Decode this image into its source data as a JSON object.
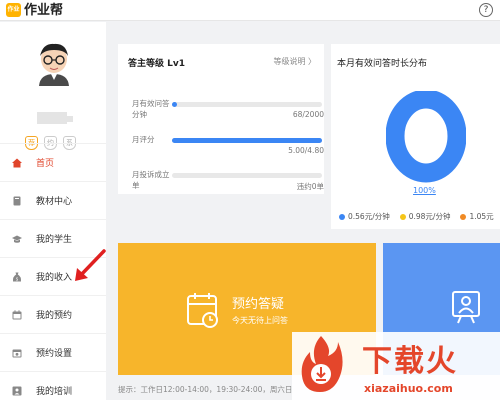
{
  "app": {
    "logo_text": "作业",
    "name": "作业帮",
    "help": "?"
  },
  "sidebar": {
    "badges": [
      "荐",
      "约",
      "系"
    ],
    "items": [
      {
        "label": "首页",
        "icon": "home-icon",
        "active": true
      },
      {
        "label": "教材中心",
        "icon": "book-icon"
      },
      {
        "label": "我的学生",
        "icon": "graduation-cap-icon"
      },
      {
        "label": "我的收入",
        "icon": "money-bag-icon"
      },
      {
        "label": "我的预约",
        "icon": "calendar-icon"
      },
      {
        "label": "预约设置",
        "icon": "calendar-settings-icon"
      },
      {
        "label": "我的培训",
        "icon": "training-icon"
      }
    ]
  },
  "level_card": {
    "title": "答主等级 Lv1",
    "link": "等级说明 〉",
    "rows": [
      {
        "label": "月有效问答分钟",
        "value": "68/2000",
        "progress": 0.034
      },
      {
        "label": "月评分",
        "value": "5.00/4.80",
        "progress": 1.0
      },
      {
        "label": "月投诉成立单",
        "value": "违约0单",
        "progress": 0
      }
    ]
  },
  "stats_card": {
    "title": "本月有效问答时长分布",
    "percent_label": "100%",
    "legend": [
      {
        "label": "0.56元/分钟",
        "color": "#3b86f4"
      },
      {
        "label": "0.98元/分钟",
        "color": "#f5c518"
      },
      {
        "label": "1.05元",
        "color": "#f08a24"
      }
    ]
  },
  "booking_card": {
    "title": "预约答疑",
    "subtitle": "今天无待上问答"
  },
  "hint": "提示：工作日12:00-14:00，19:30-24:00，周六日",
  "watermark": {
    "text": "下载火",
    "url": "xiazaihuo.com"
  }
}
